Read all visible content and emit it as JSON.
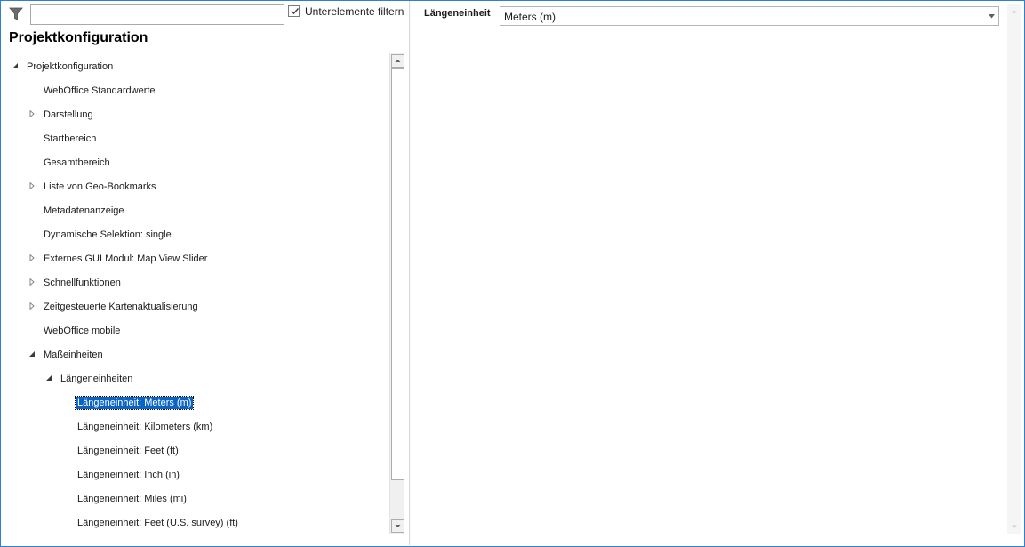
{
  "filter": {
    "input_value": "",
    "checkbox_label": "Unterelemente filtern",
    "checkbox_checked": true
  },
  "panel": {
    "title": "Projektkonfiguration"
  },
  "tree": {
    "items": [
      {
        "label": "Projektkonfiguration",
        "level": 0,
        "toggle": "expanded"
      },
      {
        "label": "WebOffice Standardwerte",
        "level": 1,
        "toggle": "none"
      },
      {
        "label": "Darstellung",
        "level": 1,
        "toggle": "collapsed"
      },
      {
        "label": "Startbereich",
        "level": 1,
        "toggle": "none"
      },
      {
        "label": "Gesamtbereich",
        "level": 1,
        "toggle": "none"
      },
      {
        "label": "Liste von Geo-Bookmarks",
        "level": 1,
        "toggle": "collapsed"
      },
      {
        "label": "Metadatenanzeige",
        "level": 1,
        "toggle": "none"
      },
      {
        "label": "Dynamische Selektion: single",
        "level": 1,
        "toggle": "none"
      },
      {
        "label": "Externes GUI Modul: Map View Slider",
        "level": 1,
        "toggle": "collapsed"
      },
      {
        "label": "Schnellfunktionen",
        "level": 1,
        "toggle": "collapsed"
      },
      {
        "label": "Zeitgesteuerte Kartenaktualisierung",
        "level": 1,
        "toggle": "collapsed"
      },
      {
        "label": "WebOffice mobile",
        "level": 1,
        "toggle": "none"
      },
      {
        "label": "Maßeinheiten",
        "level": 1,
        "toggle": "expanded"
      },
      {
        "label": "Längeneinheiten",
        "level": 2,
        "toggle": "expanded"
      },
      {
        "label": "Längeneinheit: Meters (m)",
        "level": 3,
        "toggle": "none",
        "selected": true
      },
      {
        "label": "Längeneinheit: Kilometers (km)",
        "level": 3,
        "toggle": "none"
      },
      {
        "label": "Längeneinheit: Feet (ft)",
        "level": 3,
        "toggle": "none"
      },
      {
        "label": "Längeneinheit: Inch (in)",
        "level": 3,
        "toggle": "none"
      },
      {
        "label": "Längeneinheit: Miles (mi)",
        "level": 3,
        "toggle": "none"
      },
      {
        "label": "Längeneinheit: Feet (U.S. survey) (ft)",
        "level": 3,
        "toggle": "none"
      }
    ]
  },
  "properties": {
    "field_label": "Längeneinheit",
    "field_value": "Meters (m)"
  },
  "colors": {
    "selection": "#0a64c8",
    "border_accent": "#2b7fd4"
  },
  "icons": {
    "filter": "filter-funnel-icon",
    "expanded": "triangle-expanded-icon",
    "collapsed": "triangle-collapsed-icon",
    "dropdown": "chevron-down-icon",
    "scroll_up": "scroll-up-arrow-icon",
    "scroll_down": "scroll-down-arrow-icon"
  }
}
